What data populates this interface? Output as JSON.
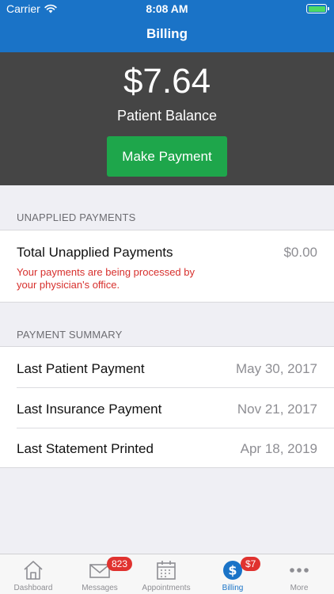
{
  "status_bar": {
    "carrier": "Carrier",
    "time": "8:08 AM"
  },
  "nav": {
    "title": "Billing"
  },
  "balance": {
    "amount": "$7.64",
    "label": "Patient Balance",
    "button": "Make Payment"
  },
  "unapplied": {
    "header": "UNAPPLIED PAYMENTS",
    "label": "Total Unapplied Payments",
    "value": "$0.00",
    "warning": "Your payments are being processed by your physician's office."
  },
  "summary": {
    "header": "PAYMENT SUMMARY",
    "rows": [
      {
        "label": "Last Patient Payment",
        "value": "May 30, 2017"
      },
      {
        "label": "Last Insurance Payment",
        "value": "Nov 21, 2017"
      },
      {
        "label": "Last Statement Printed",
        "value": "Apr 18, 2019"
      }
    ]
  },
  "tabs": [
    {
      "label": "Dashboard",
      "icon": "home-icon"
    },
    {
      "label": "Messages",
      "icon": "envelope-icon",
      "badge": "823"
    },
    {
      "label": "Appointments",
      "icon": "calendar-icon"
    },
    {
      "label": "Billing",
      "icon": "dollar-icon",
      "badge": "$7",
      "active": true
    },
    {
      "label": "More",
      "icon": "more-icon"
    }
  ],
  "colors": {
    "primary": "#1a73c7",
    "panel": "#454545",
    "success": "#1ea64b",
    "danger": "#d7302d",
    "badge": "#e0322f"
  }
}
